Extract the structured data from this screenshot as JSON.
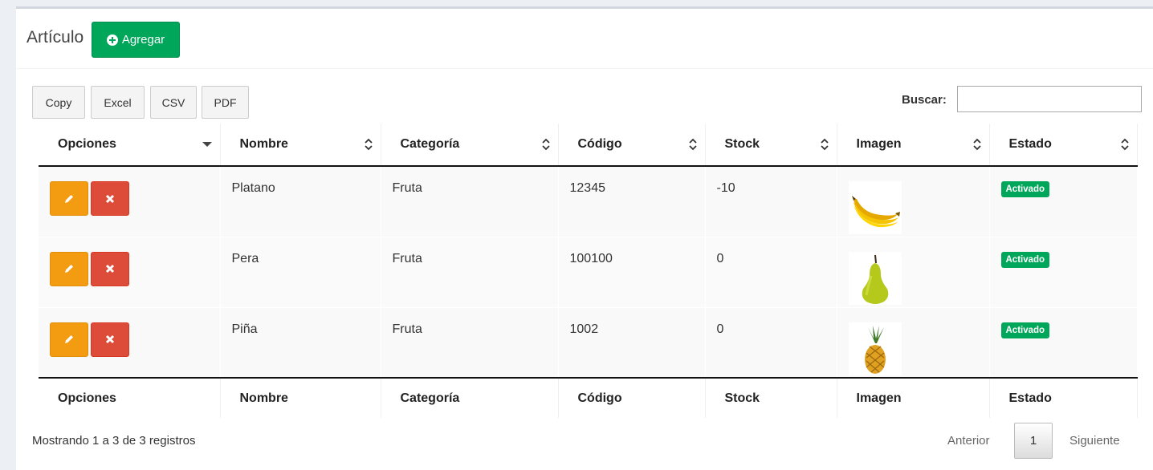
{
  "header": {
    "title": "Artículo",
    "add_label": "Agregar"
  },
  "toolbar": {
    "buttons": [
      "Copy",
      "Excel",
      "CSV",
      "PDF"
    ],
    "search_label": "Buscar:",
    "search_value": ""
  },
  "table": {
    "columns": [
      "Opciones",
      "Nombre",
      "Categoría",
      "Código",
      "Stock",
      "Imagen",
      "Estado"
    ],
    "rows": [
      {
        "nombre": "Platano",
        "categoria": "Fruta",
        "codigo": "12345",
        "stock": "-10",
        "imagen": "banana-image",
        "estado": "Activado"
      },
      {
        "nombre": "Pera",
        "categoria": "Fruta",
        "codigo": "100100",
        "stock": "0",
        "imagen": "pear-image",
        "estado": "Activado"
      },
      {
        "nombre": "Piña",
        "categoria": "Fruta",
        "codigo": "1002",
        "stock": "0",
        "imagen": "pineapple-image",
        "estado": "Activado"
      }
    ],
    "row_action_icons": [
      "pencil-icon",
      "times-icon"
    ]
  },
  "footer": {
    "info": "Mostrando 1 a 3 de 3 registros",
    "prev_label": "Anterior",
    "current_page": "1",
    "next_label": "Siguiente"
  },
  "colors": {
    "success": "#00a65a",
    "warning": "#f39c12",
    "danger": "#dd4b39"
  }
}
